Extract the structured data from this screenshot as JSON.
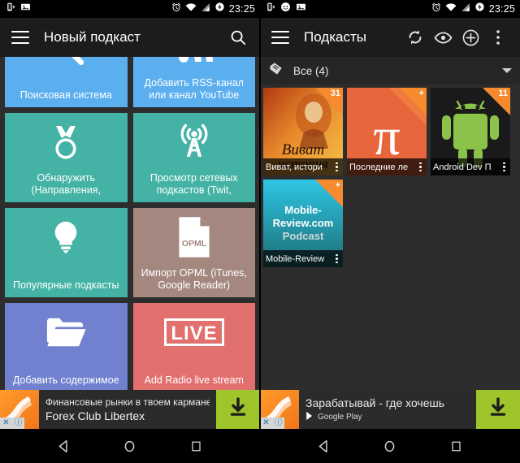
{
  "status_bar": {
    "time": "23:25",
    "icons_left_panel": [
      "vibrate-icon",
      "image-icon"
    ],
    "icons_right_panel": [
      "vibrate-icon",
      "face-icon",
      "image-icon"
    ],
    "icons_right": [
      "alarm-icon",
      "wifi-icon",
      "signal-icon",
      "battery-saver-icon"
    ]
  },
  "left_panel": {
    "action_bar": {
      "menu_label": "menu",
      "title": "Новый подкаст",
      "search_label": "search"
    },
    "tiles": [
      {
        "label": "Поисковая система",
        "color": "#5bafef",
        "icon": "magnifier-icon"
      },
      {
        "label": "Добавить RSS-канал или канал YouTube",
        "color": "#5bafef",
        "icon": "rss-icon"
      },
      {
        "label": "Обнаружить (Направления, новинки,",
        "color": "#44b3a5",
        "icon": "medal-icon"
      },
      {
        "label": "Просмотр сетевых подкастов (Twit,",
        "color": "#44b3a5",
        "icon": "antenna-icon"
      },
      {
        "label": "Популярные подкасты",
        "color": "#44b3a5",
        "icon": "lightbulb-icon"
      },
      {
        "label": "Импорт OPML (iTunes, Google Reader)",
        "color": "#a4887f",
        "icon": "opml-file-icon",
        "icon_text": "OPML"
      },
      {
        "label": "Добавить содержимое",
        "color": "#7180cf",
        "icon": "folder-icon"
      },
      {
        "label": "Add Radio live stream",
        "color": "#e2706f",
        "icon": "live-icon",
        "icon_text": "LIVE"
      }
    ],
    "ad": {
      "line1": "Финансовые рынки в твоем кармане!",
      "line2": "Forex Club Libertex",
      "close_badge": "✕",
      "info_badge": "ⓘ",
      "cta": "download-icon"
    }
  },
  "right_panel": {
    "action_bar": {
      "menu_label": "menu",
      "title": "Подкасты",
      "refresh_label": "refresh",
      "eye_label": "visibility",
      "add_label": "add",
      "overflow_label": "more options"
    },
    "filter": {
      "icon": "tag-icon",
      "label": "Все (4)",
      "caret": "chevron-down-icon"
    },
    "podcasts": [
      {
        "name": "Виват, истори",
        "badge": "31",
        "art": "vivat-history-art"
      },
      {
        "name": "Последние ле",
        "badge": "+",
        "art": "pi-symbol-art"
      },
      {
        "name": "Android Dev П",
        "badge": "11",
        "art": "android-robot-art"
      },
      {
        "name": "Mobile-Review",
        "badge": "+",
        "art": "mobile-review-art",
        "art_text": "Mobile-Review.com Podcast"
      }
    ],
    "ad": {
      "line1": "Зарабатывай - где хочешь",
      "line2": "Google Play",
      "close_badge": "✕",
      "info_badge": "ⓘ",
      "cta": "download-icon"
    }
  },
  "nav_bar": {
    "back_label": "back",
    "home_label": "home",
    "recents_label": "recent apps"
  },
  "colors": {
    "tile_blue": "#5bafef",
    "tile_teal": "#44b3a5",
    "tile_brown": "#a4887f",
    "tile_purple": "#7180cf",
    "tile_red": "#e2706f",
    "accent_orange": "#f68a2e",
    "cta_green": "#9ec62a",
    "background": "#2d2d2d"
  }
}
